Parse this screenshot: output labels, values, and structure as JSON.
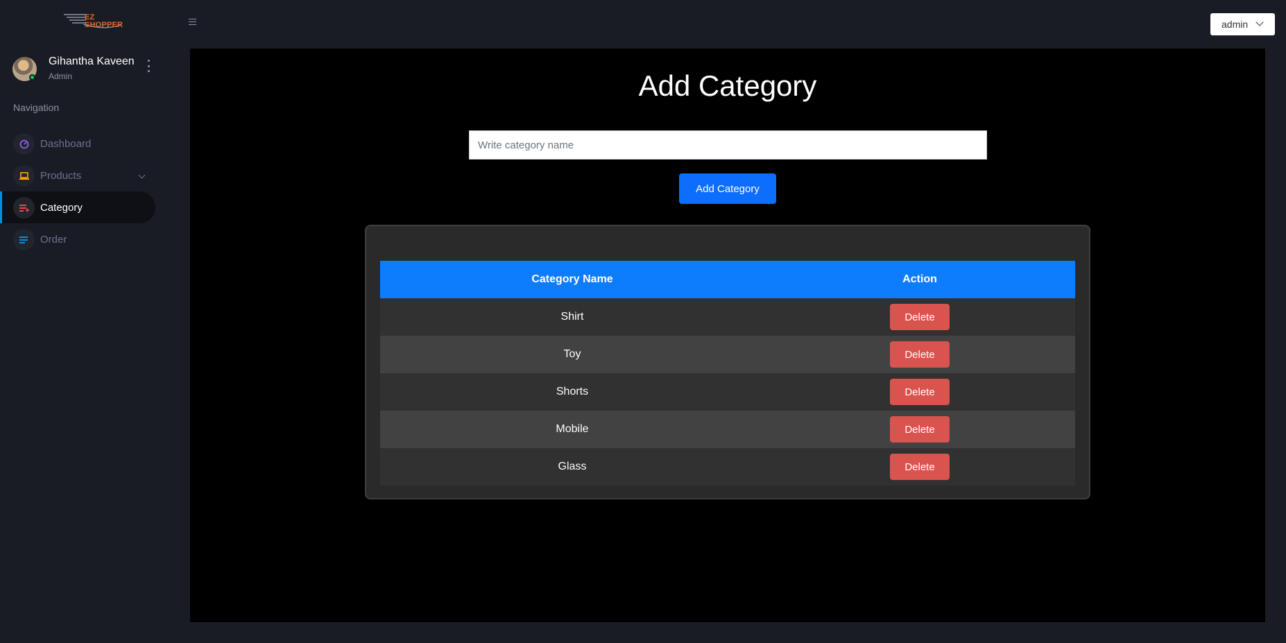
{
  "brand": {
    "logo_text": "EZ SHOPPER"
  },
  "profile": {
    "name": "Gihantha Kaveen",
    "role": "Admin"
  },
  "nav": {
    "heading": "Navigation",
    "items": [
      {
        "label": "Dashboard",
        "icon": "speedometer-icon",
        "color": "#8f5fe8"
      },
      {
        "label": "Products",
        "icon": "laptop-icon",
        "color": "#ffab00"
      },
      {
        "label": "Category",
        "icon": "playlist-icon",
        "color": "#fc424a",
        "active": true
      },
      {
        "label": "Order",
        "icon": "list-icon",
        "color": "#0090e7"
      }
    ]
  },
  "topbar": {
    "user_menu_label": "admin"
  },
  "main": {
    "title": "Add Category",
    "input_placeholder": "Write category name",
    "input_value": "",
    "submit_label": "Add Category",
    "table": {
      "headers": [
        "Category Name",
        "Action"
      ],
      "rows": [
        {
          "name": "Shirt",
          "action": "Delete"
        },
        {
          "name": "Toy",
          "action": "Delete"
        },
        {
          "name": "Shorts",
          "action": "Delete"
        },
        {
          "name": "Mobile",
          "action": "Delete"
        },
        {
          "name": "Glass",
          "action": "Delete"
        }
      ]
    }
  },
  "colors": {
    "accent": "#0d6efd",
    "danger": "#d9534f",
    "sidebar_bg": "#191c24"
  }
}
